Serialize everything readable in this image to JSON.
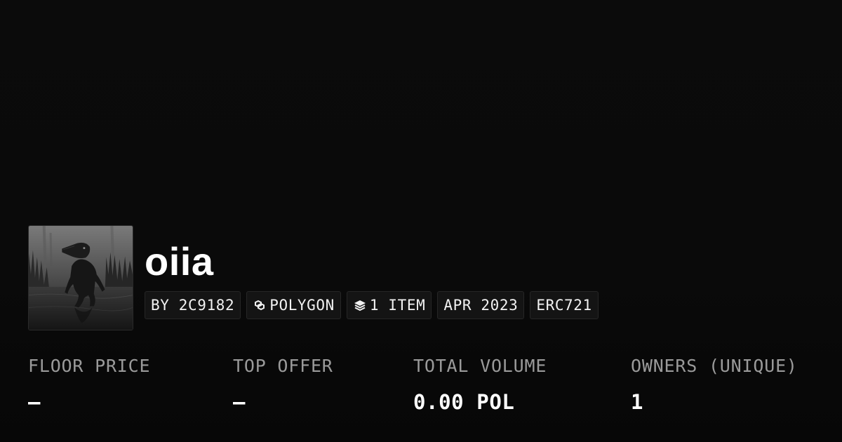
{
  "collection": {
    "name": "oiia",
    "avatar_icon": "swamp-creature-image"
  },
  "tags": [
    {
      "label": "BY 2C9182",
      "icon": ""
    },
    {
      "label": "POLYGON",
      "icon": "polygon-chain-icon"
    },
    {
      "label": "1 ITEM",
      "icon": "stack-layers-icon"
    },
    {
      "label": "APR 2023",
      "icon": ""
    },
    {
      "label": "ERC721",
      "icon": ""
    }
  ],
  "stats": [
    {
      "label": "FLOOR PRICE",
      "value": "–"
    },
    {
      "label": "TOP OFFER",
      "value": "–"
    },
    {
      "label": "TOTAL VOLUME",
      "value": "0.00 POL"
    },
    {
      "label": "OWNERS (UNIQUE)",
      "value": "1"
    }
  ],
  "colors": {
    "background": "#0b0b0b",
    "tag_background": "#141414",
    "label_gray": "#9a9a9a",
    "text": "#ffffff"
  }
}
